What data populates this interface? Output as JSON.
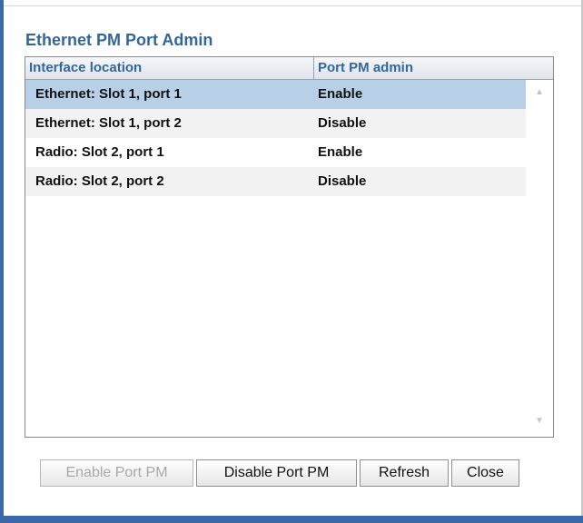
{
  "dialog": {
    "title": "Ethernet PM Port Admin"
  },
  "table": {
    "columns": [
      "Interface location",
      "Port PM admin"
    ],
    "rows": [
      {
        "location": "Ethernet: Slot 1, port 1",
        "admin": "Enable",
        "selected": true
      },
      {
        "location": "Ethernet: Slot 1, port 2",
        "admin": "Disable",
        "selected": false
      },
      {
        "location": "Radio: Slot 2, port 1",
        "admin": "Enable",
        "selected": false
      },
      {
        "location": "Radio: Slot 2, port 2",
        "admin": "Disable",
        "selected": false
      }
    ]
  },
  "buttons": {
    "enable": "Enable Port PM",
    "disable": "Disable Port PM",
    "refresh": "Refresh",
    "close": "Close"
  },
  "icons": {
    "scroll_up": "scroll-up-arrow-icon",
    "scroll_down": "scroll-down-arrow-icon"
  },
  "colors": {
    "accent": "#336699",
    "selection": "#b8cfe8",
    "frame": "#3a68a8"
  }
}
